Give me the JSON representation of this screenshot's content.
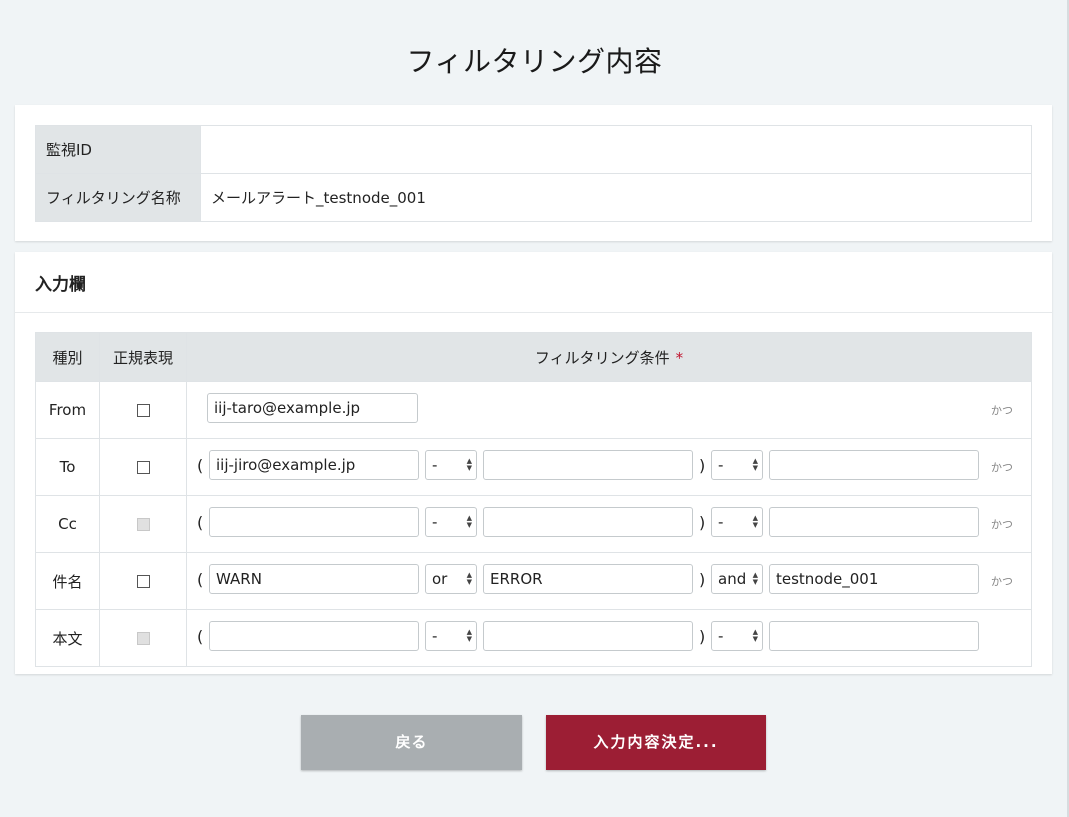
{
  "page": {
    "title": "フィルタリング内容"
  },
  "info": {
    "monitor_id_label": "監視ID",
    "monitor_id_value": "",
    "filter_name_label": "フィルタリング名称",
    "filter_name_value": "メールアラート_testnode_001"
  },
  "input_section": {
    "heading": "入力欄",
    "headers": {
      "type": "種別",
      "regex": "正規表現",
      "condition": "フィルタリング条件",
      "required_mark": "*"
    },
    "rows": [
      {
        "type": "From",
        "regex_enabled": true,
        "regex_checked": false,
        "value1": "iij-taro@example.jp",
        "katsu": "かつ"
      },
      {
        "type": "To",
        "regex_enabled": true,
        "regex_checked": false,
        "open_paren": "(",
        "value1": "iij-jiro@example.jp",
        "op1": "-",
        "value2": "",
        "close_paren": ")",
        "op2": "-",
        "value3": "",
        "katsu": "かつ"
      },
      {
        "type": "Cc",
        "regex_enabled": false,
        "regex_checked": false,
        "open_paren": "(",
        "value1": "",
        "op1": "-",
        "value2": "",
        "close_paren": ")",
        "op2": "-",
        "value3": "",
        "katsu": "かつ"
      },
      {
        "type": "件名",
        "regex_enabled": true,
        "regex_checked": false,
        "open_paren": "(",
        "value1": "WARN",
        "op1": "or",
        "value2": "ERROR",
        "close_paren": ")",
        "op2": "and",
        "value3": "testnode_001",
        "katsu": "かつ"
      },
      {
        "type": "本文",
        "regex_enabled": false,
        "regex_checked": false,
        "open_paren": "(",
        "value1": "",
        "op1": "-",
        "value2": "",
        "close_paren": ")",
        "op2": "-",
        "value3": ""
      }
    ]
  },
  "buttons": {
    "back": "戻る",
    "confirm": "入力内容決定..."
  },
  "colors": {
    "confirm": "#9c1e34",
    "back": "#a9aeb1",
    "required": "#c0132e"
  }
}
